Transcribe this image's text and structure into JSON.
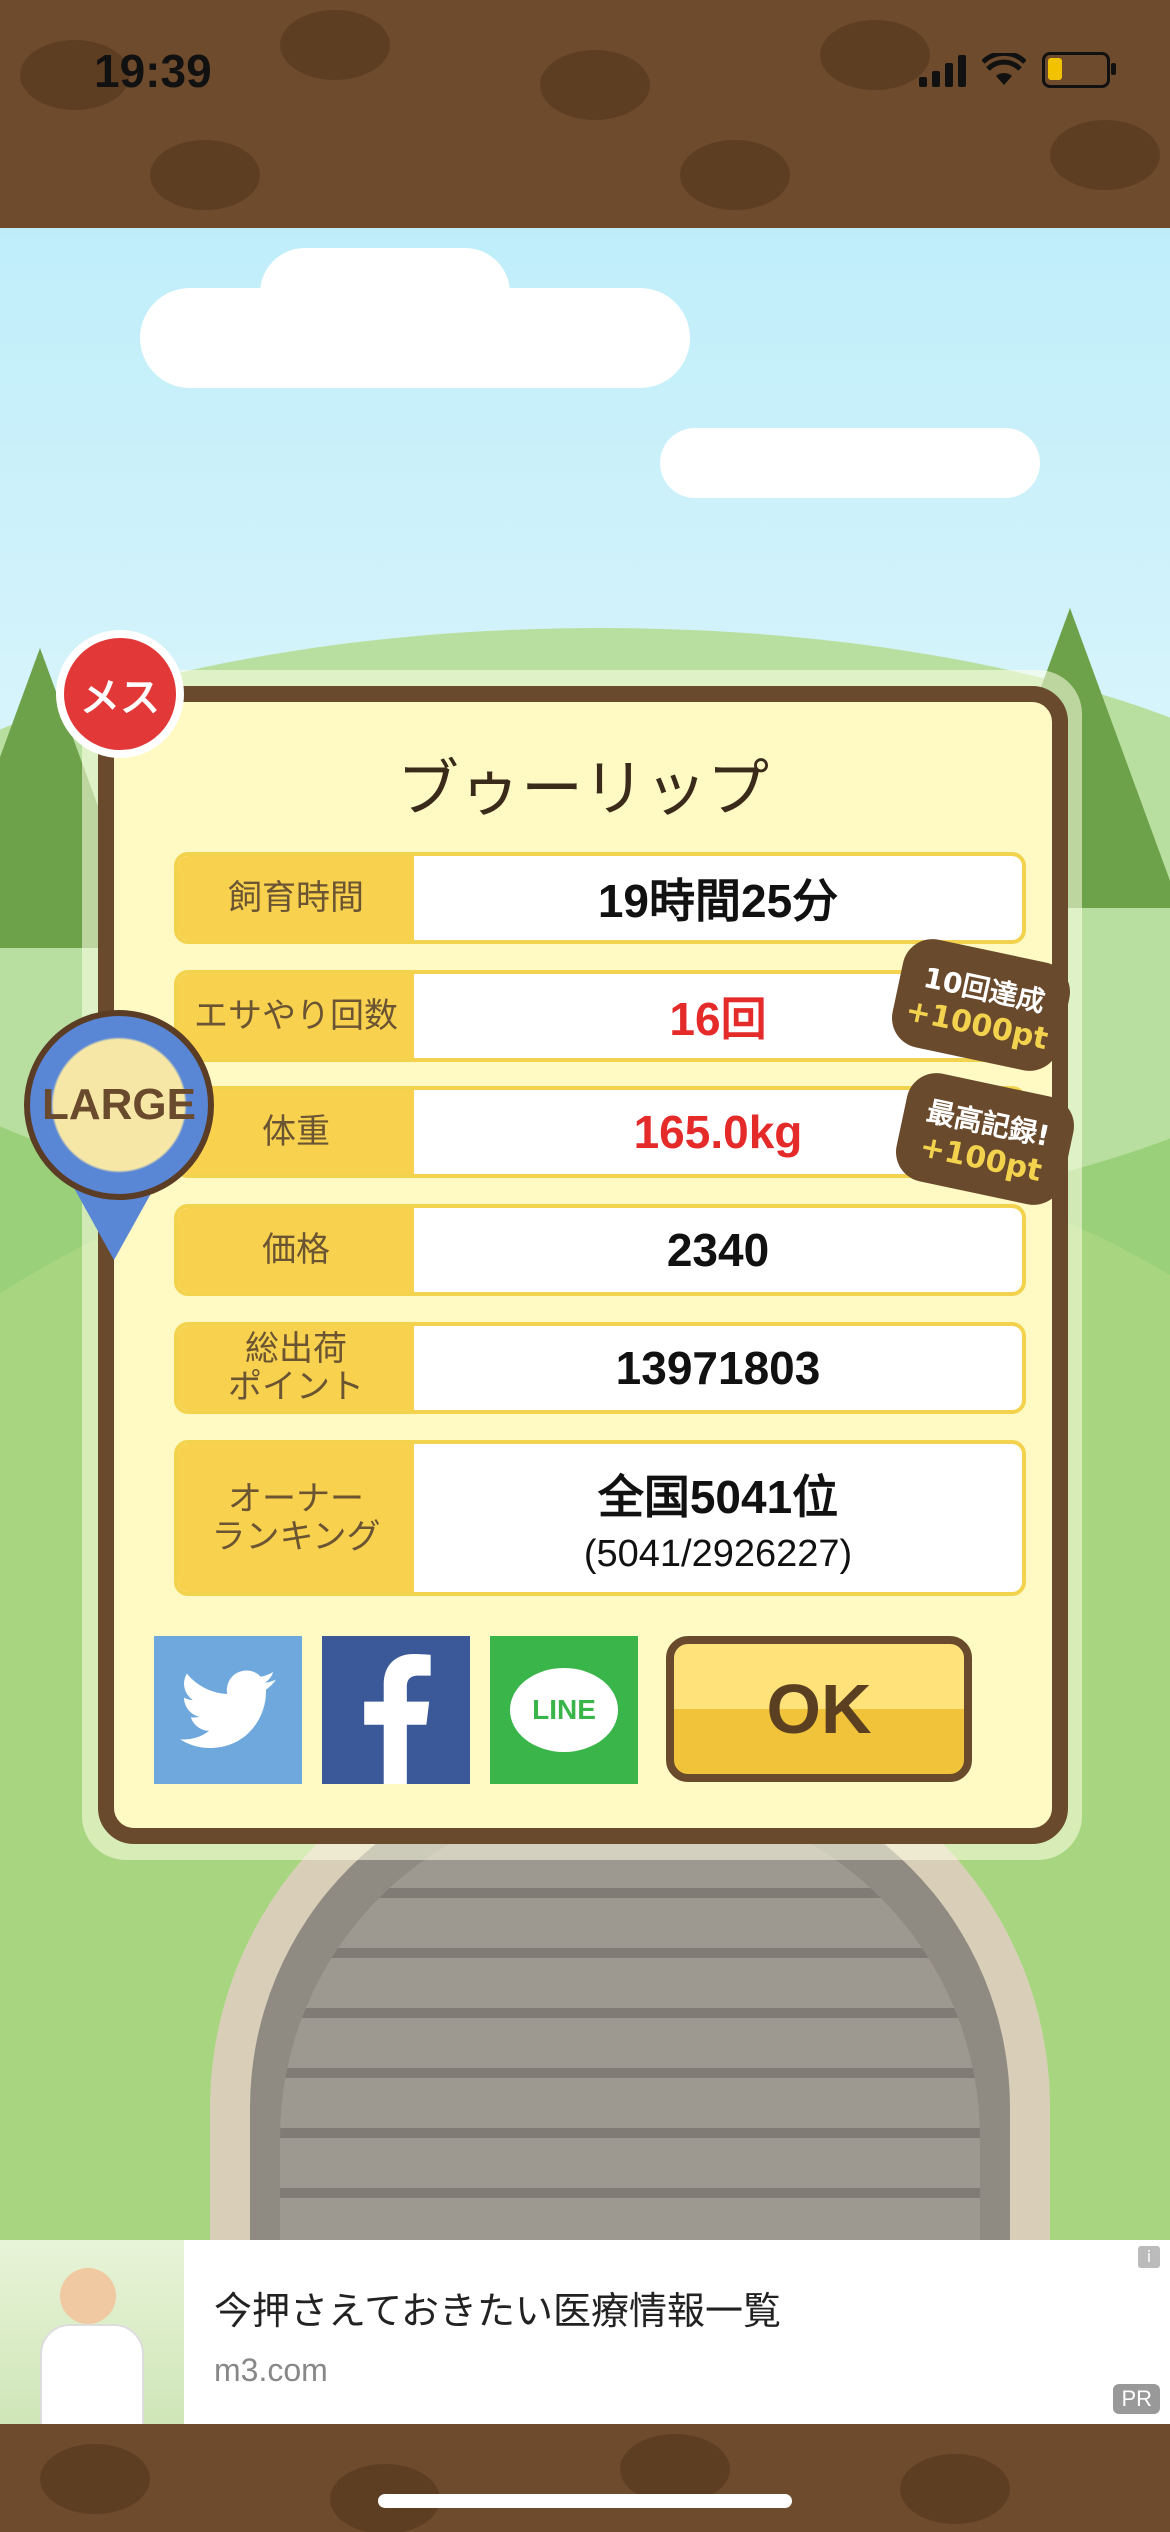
{
  "status_bar": {
    "time": "19:39"
  },
  "pet": {
    "gender_label": "メス",
    "name": "ブゥーリップ",
    "size_badge": "LARGE"
  },
  "stats": [
    {
      "label": "飼育時間",
      "value": "19時間25分",
      "highlight": false
    },
    {
      "label": "エサやり回数",
      "value": "16回",
      "highlight": true
    },
    {
      "label": "体重",
      "value": "165.0kg",
      "highlight": true
    },
    {
      "label": "価格",
      "value": "2340",
      "highlight": false
    },
    {
      "label": "総出荷\nポイント",
      "value": "13971803",
      "highlight": false
    },
    {
      "label": "オーナー\nランキング",
      "value": "全国5041位",
      "sub": "(5041/2926227)",
      "highlight": false
    }
  ],
  "badges": [
    {
      "top": "10回達成",
      "bottom": "+1000pt"
    },
    {
      "top": "最高記録!",
      "bottom": "+100pt"
    }
  ],
  "share": {
    "twitter_icon": "twitter-icon",
    "facebook_icon": "facebook-icon",
    "line_label": "LINE"
  },
  "ok_button": {
    "label": "OK"
  },
  "ad": {
    "title": "今押さえておきたい医療情報一覧",
    "url": "m3.com",
    "pr_label": "PR",
    "info_label": "i"
  },
  "colors": {
    "frame": "#6a4a2c",
    "label_bg": "#f8d24f",
    "panel_bg": "#fff9c4",
    "highlight": "#e52a2a",
    "twitter": "#6fa8dc",
    "facebook": "#3b5998",
    "line": "#39b54a"
  }
}
